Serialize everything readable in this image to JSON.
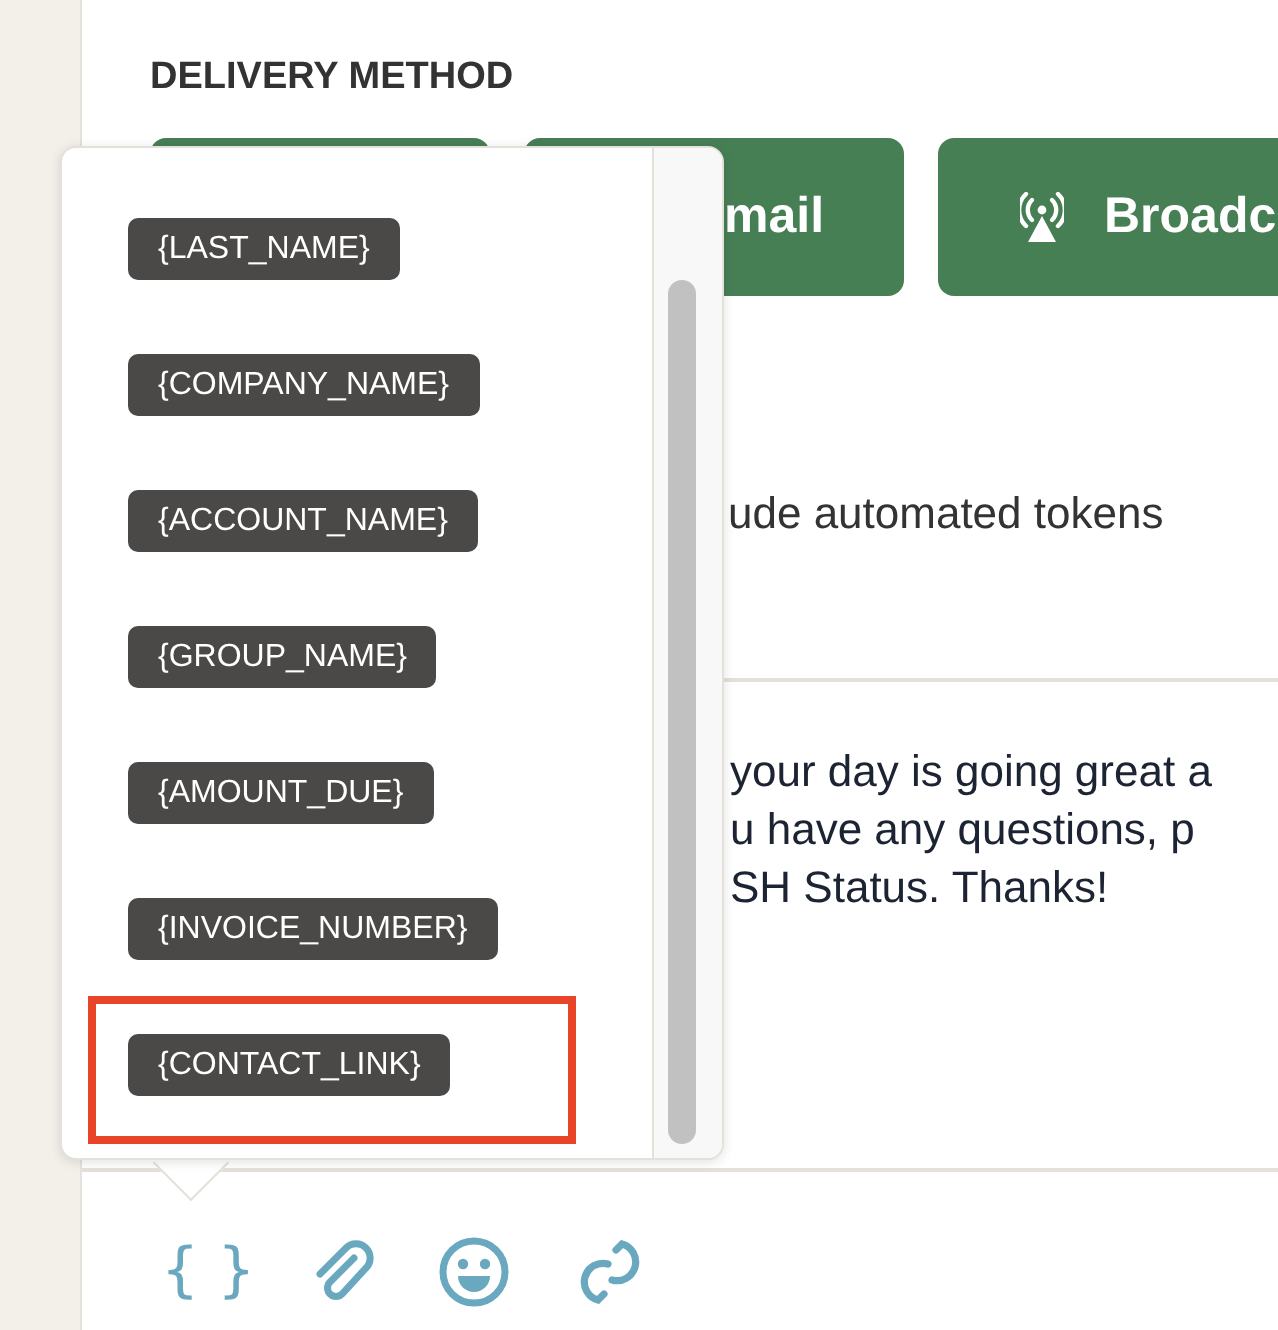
{
  "section_title": "DELIVERY METHOD",
  "delivery_buttons": [
    {
      "kind": "plain"
    },
    {
      "kind": "plain",
      "label": "mail"
    },
    {
      "kind": "broadcast",
      "label": "Broadc"
    }
  ],
  "hint": "ude automated tokens",
  "message_lines": [
    "your day is going great a",
    "u have any questions, p",
    "SH Status. Thanks!"
  ],
  "token_menu": {
    "items": [
      {
        "label": "{LAST_NAME}",
        "highlighted": false
      },
      {
        "label": "{COMPANY_NAME}",
        "highlighted": false
      },
      {
        "label": "{ACCOUNT_NAME}",
        "highlighted": false
      },
      {
        "label": "{GROUP_NAME}",
        "highlighted": false
      },
      {
        "label": "{AMOUNT_DUE}",
        "highlighted": false
      },
      {
        "label": "{INVOICE_NUMBER}",
        "highlighted": false
      },
      {
        "label": "{CONTACT_LINK}",
        "highlighted": true
      }
    ]
  },
  "toolbar": [
    {
      "kind": "token",
      "label": "{ }"
    },
    {
      "kind": "attach"
    },
    {
      "kind": "emoji"
    },
    {
      "kind": "link"
    }
  ]
}
